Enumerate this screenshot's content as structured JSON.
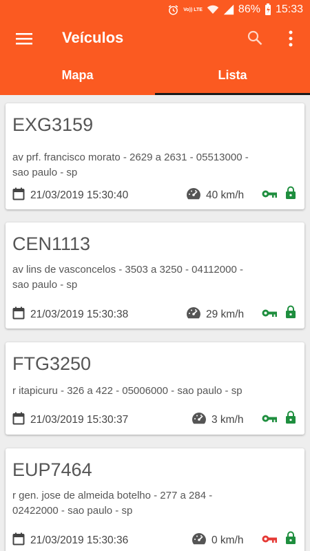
{
  "status_bar": {
    "battery": "86%",
    "time": "15:33",
    "volte_label": "Vo)) LTE"
  },
  "app_bar": {
    "title": "Veículos",
    "icons": [
      "menu-icon",
      "search-icon",
      "more-vert-icon"
    ]
  },
  "tabs": [
    {
      "label": "Mapa",
      "active": false
    },
    {
      "label": "Lista",
      "active": true
    }
  ],
  "vehicles": [
    {
      "plate": "EXG3159",
      "address_line1": "av prf. francisco morato - 2629 a 2631 - 05513000 -",
      "address_line2": "sao paulo - sp",
      "datetime": "21/03/2019 15:30:40",
      "speed": "40 km/h",
      "ignition": "on",
      "locked": true
    },
    {
      "plate": "CEN1113",
      "address_line1": "av lins de vasconcelos - 3503 a 3250 - 04112000 -",
      "address_line2": "sao paulo - sp",
      "datetime": "21/03/2019 15:30:38",
      "speed": "29 km/h",
      "ignition": "on",
      "locked": true
    },
    {
      "plate": "FTG3250",
      "address_line1": "r itapicuru - 326 a 422 - 05006000 - sao paulo - sp",
      "address_line2": "",
      "datetime": "21/03/2019 15:30:37",
      "speed": "3 km/h",
      "ignition": "on",
      "locked": true
    },
    {
      "plate": "EUP7464",
      "address_line1": "r gen. jose de almeida botelho - 277 a 284 -",
      "address_line2": "02422000 - sao paulo - sp",
      "datetime": "21/03/2019 15:30:36",
      "speed": "0 km/h",
      "ignition": "off",
      "locked": true
    }
  ],
  "colors": {
    "primary": "#fb5a21",
    "tab_indicator": "#1a1a1a",
    "ignition_on": "#1e8e3e",
    "ignition_off": "#e53935",
    "lock": "#1e8e3e",
    "background": "#eeeeee"
  }
}
